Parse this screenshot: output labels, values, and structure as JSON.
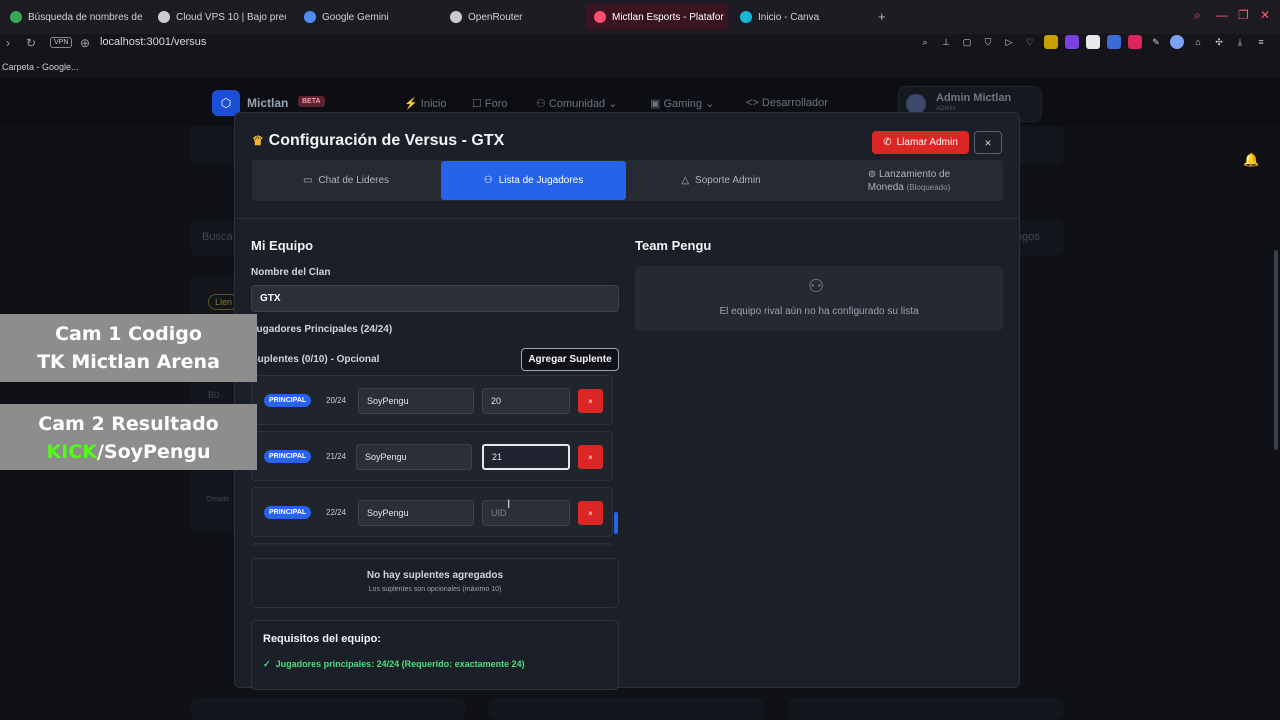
{
  "browser": {
    "tabs": [
      {
        "title": "Búsqueda de nombres de",
        "active": false,
        "color": "#34a853"
      },
      {
        "title": "Cloud VPS 10 | Bajo prec",
        "active": false,
        "color": "#cccccc"
      },
      {
        "title": "Google Gemini",
        "active": false,
        "color": "#4f8df7"
      },
      {
        "title": "OpenRouter",
        "active": false,
        "color": "#cccccc"
      },
      {
        "title": "Mictlan Esports - Platafor",
        "active": true,
        "color": "#ff4d6d"
      },
      {
        "title": "Inicio - Canva",
        "active": false,
        "color": "#18b6d6"
      }
    ],
    "vpn_label": "VPN",
    "url": "localhost:3001/versus",
    "bookmark": "Carpeta - Google..."
  },
  "site": {
    "brand": "Mictlan",
    "beta": "BETA",
    "nav": [
      "Inicio",
      "Foro",
      "Comunidad",
      "Gaming",
      "Desarrollador"
    ],
    "user_name": "Admin Mictlan",
    "user_role": "ADMIN",
    "bg_search": "Busca",
    "bg_filter": "egos",
    "bg_tag": "Llen",
    "bg_b": "B0",
    "bg_created": "Creado"
  },
  "modal": {
    "title": "Configuración de Versus - GTX",
    "call_admin": "Llamar Admin",
    "close": "×",
    "tabs": {
      "chat": "Chat de Lideres",
      "players": "Lista de Jugadores",
      "support": "Soporte Admin",
      "coin": "Lanzamiento de",
      "coin2": "Moneda",
      "coin_locked": "(Bloqueado)"
    },
    "my_team": {
      "title": "Mi Equipo",
      "clan_label": "Nombre del Clan",
      "clan_value": "GTX",
      "principals": "Jugadores Principales (24/24)",
      "subs": "Suplentes (0/10) - Opcional",
      "add_sub": "Agregar Suplente",
      "players": [
        {
          "badge": "PRINCIPAL",
          "count": "20/24",
          "nick": "SoyPengu",
          "uid": "20",
          "uid_placeholder": "UID"
        },
        {
          "badge": "PRINCIPAL",
          "count": "21/24",
          "nick": "SoyPengu",
          "uid": "21",
          "uid_placeholder": "UID"
        },
        {
          "badge": "PRINCIPAL",
          "count": "22/24",
          "nick": "SoyPengu",
          "uid": "",
          "uid_placeholder": "UID"
        }
      ],
      "delete": "×",
      "no_subs": "No hay suplentes agregados",
      "no_subs_hint": "Los suplentes son opcionales (máximo 10)",
      "req_title": "Requisitos del equipo:",
      "req_check": "✓",
      "req_principals": "Jugadores principales: 24/24 (Requerido: exactamente 24)"
    },
    "rival": {
      "title": "Team Pengu",
      "empty": "El equipo rival aún no ha configurado su lista"
    }
  },
  "overlays": {
    "cam1_line1": "Cam 1 Codigo",
    "cam1_line2": "TK Mictlan Arena",
    "cam2_line1": "Cam 2 Resultado",
    "cam2_kick": "KICK",
    "cam2_rest": "/SoyPengu"
  },
  "colors": {
    "accent": "#2563eb",
    "danger": "#dc2626",
    "success": "#4ade80",
    "kick": "#53fc18"
  }
}
